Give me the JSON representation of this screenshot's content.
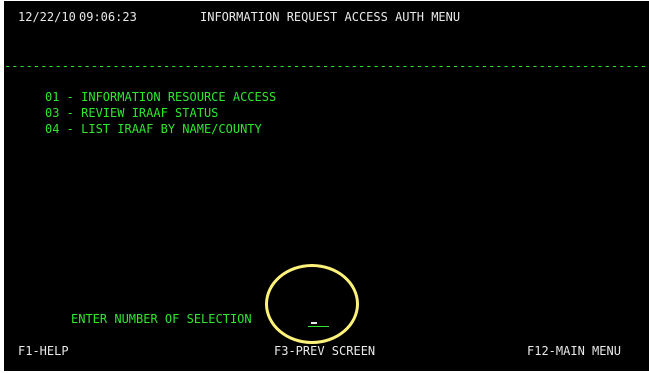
{
  "header": {
    "date": "12/22/10",
    "time": "09:06:23",
    "title": "INFORMATION REQUEST ACCESS AUTH MENU"
  },
  "divider": "--------------------------------------------------------------------------------------------------------------------------------",
  "menu": {
    "options": [
      {
        "label": "01 - INFORMATION RESOURCE ACCESS"
      },
      {
        "label": "03 - REVIEW IRAAF STATUS"
      },
      {
        "label": "04 - LIST IRAAF BY NAME/COUNTY"
      }
    ]
  },
  "prompt": {
    "label": "ENTER NUMBER OF SELECTION",
    "value": ""
  },
  "function_keys": {
    "f1": "F1-HELP",
    "f3": "F3-PREV SCREEN",
    "f12": "F12-MAIN MENU"
  },
  "colors": {
    "background": "#000000",
    "header_text": "#e8e8e8",
    "menu_text": "#2fe62f",
    "highlight_circle": "#fff27a"
  }
}
